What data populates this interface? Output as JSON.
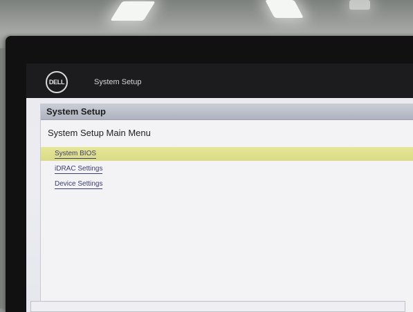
{
  "topbar": {
    "logo_text": "DELL",
    "title": "System Setup"
  },
  "panel": {
    "header": "System Setup",
    "menu_title": "System Setup Main Menu",
    "items": [
      {
        "label": "System BIOS",
        "selected": true
      },
      {
        "label": "iDRAC Settings",
        "selected": false
      },
      {
        "label": "Device Settings",
        "selected": false
      }
    ]
  },
  "colors": {
    "topbar": "#1c1c1e",
    "selection": "#dadb86",
    "link": "#3b3c6e"
  }
}
